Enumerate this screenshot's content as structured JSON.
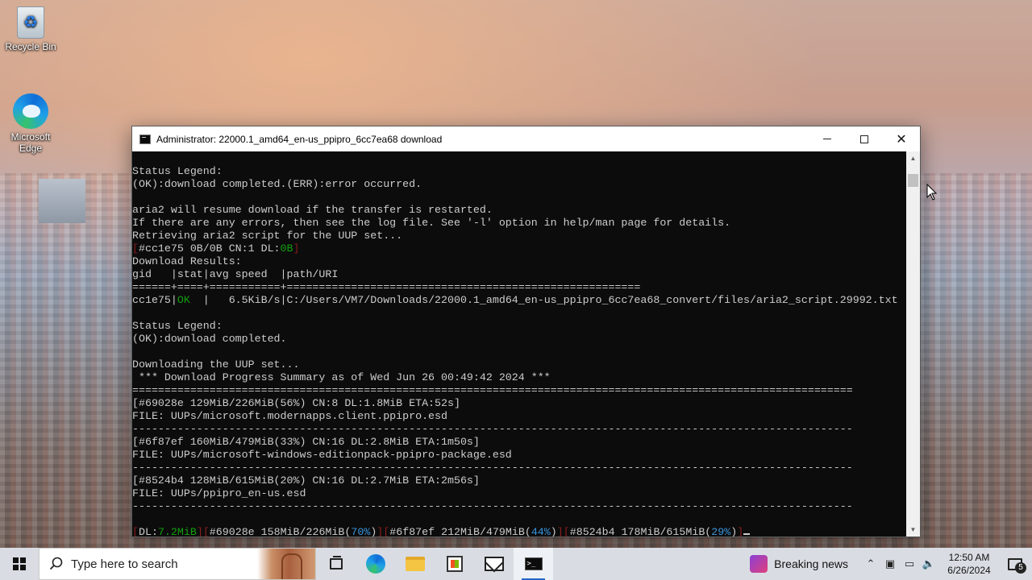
{
  "desktop": {
    "icons": [
      {
        "label": "Recycle Bin",
        "icon": "recycle-bin-icon"
      },
      {
        "label": "Microsoft Edge",
        "icon": "edge-icon"
      }
    ]
  },
  "window": {
    "title": "Administrator:  22000.1_amd64_en-us_ppipro_6cc7ea68 download",
    "controls": {
      "minimize": "minimize-icon",
      "maximize": "maximize-icon",
      "close": "close-icon"
    }
  },
  "console": {
    "lines": [
      [
        {
          "t": "Status Legend:"
        }
      ],
      [
        {
          "t": "(OK):download completed.(ERR):error occurred."
        }
      ],
      [
        {
          "t": ""
        }
      ],
      [
        {
          "t": "aria2 will resume download if the transfer is restarted."
        }
      ],
      [
        {
          "t": "If there are any errors, then see the log file. See '-l' option in help/man page for details."
        }
      ],
      [
        {
          "t": "Retrieving aria2 script for the UUP set..."
        }
      ],
      [
        {
          "t": "[",
          "c": "r"
        },
        {
          "t": "#cc1e75 0B/0B CN:1 DL:"
        },
        {
          "t": "0B",
          "c": "g"
        },
        {
          "t": "]",
          "c": "r"
        }
      ],
      [
        {
          "t": "Download Results:"
        }
      ],
      [
        {
          "t": "gid   |stat|avg speed  |path/URI"
        }
      ],
      [
        {
          "t": "======+====+===========+======================================================="
        }
      ],
      [
        {
          "t": "cc1e75|"
        },
        {
          "t": "OK",
          "c": "g"
        },
        {
          "t": "  |   6.5KiB/s|C:/Users/VM7/Downloads/22000.1_amd64_en-us_ppipro_6cc7ea68_convert/files/aria2_script.29992.txt"
        }
      ],
      [
        {
          "t": ""
        }
      ],
      [
        {
          "t": "Status Legend:"
        }
      ],
      [
        {
          "t": "(OK):download completed."
        }
      ],
      [
        {
          "t": ""
        }
      ],
      [
        {
          "t": "Downloading the UUP set..."
        }
      ],
      [
        {
          "t": " *** Download Progress Summary as of Wed Jun 26 00:49:42 2024 ***"
        }
      ],
      [
        {
          "t": "================================================================================================================"
        }
      ],
      [
        {
          "t": "[#69028e 129MiB/226MiB(56%) CN:8 DL:1.8MiB ETA:52s]"
        }
      ],
      [
        {
          "t": "FILE: UUPs/microsoft.modernapps.client.ppipro.esd"
        }
      ],
      [
        {
          "t": "----------------------------------------------------------------------------------------------------------------"
        }
      ],
      [
        {
          "t": "[#6f87ef 160MiB/479MiB(33%) CN:16 DL:2.8MiB ETA:1m50s]"
        }
      ],
      [
        {
          "t": "FILE: UUPs/microsoft-windows-editionpack-ppipro-package.esd"
        }
      ],
      [
        {
          "t": "----------------------------------------------------------------------------------------------------------------"
        }
      ],
      [
        {
          "t": "[#8524b4 128MiB/615MiB(20%) CN:16 DL:2.7MiB ETA:2m56s]"
        }
      ],
      [
        {
          "t": "FILE: UUPs/ppipro_en-us.esd"
        }
      ],
      [
        {
          "t": "----------------------------------------------------------------------------------------------------------------"
        }
      ],
      [
        {
          "t": ""
        }
      ],
      [
        {
          "t": "[",
          "c": "r"
        },
        {
          "t": "DL:"
        },
        {
          "t": "7.2MiB",
          "c": "g"
        },
        {
          "t": "]",
          "c": "r"
        },
        {
          "t": "[",
          "c": "r"
        },
        {
          "t": "#69028e 158MiB/226MiB("
        },
        {
          "t": "70%",
          "c": "c"
        },
        {
          "t": ")"
        },
        {
          "t": "]",
          "c": "r"
        },
        {
          "t": "[",
          "c": "r"
        },
        {
          "t": "#6f87ef 212MiB/479MiB("
        },
        {
          "t": "44%",
          "c": "c"
        },
        {
          "t": ")"
        },
        {
          "t": "]",
          "c": "r"
        },
        {
          "t": "[",
          "c": "r"
        },
        {
          "t": "#8524b4 178MiB/615MiB("
        },
        {
          "t": "29%",
          "c": "c"
        },
        {
          "t": ")"
        },
        {
          "t": "]",
          "c": "r"
        }
      ]
    ],
    "colors": {
      "background": "#0c0c0c",
      "text": "#cccccc",
      "green": "#13a10e",
      "cyan": "#3a96dd",
      "bracket": "#8b1c1c"
    }
  },
  "taskbar": {
    "search_placeholder": "Type here to search",
    "apps": [
      "task-view-icon",
      "edge-icon",
      "file-explorer-icon",
      "microsoft-store-icon",
      "mail-icon",
      "command-prompt-icon"
    ],
    "news_label": "Breaking news",
    "time": "12:50 AM",
    "date": "6/26/2024",
    "notification_count": "5"
  }
}
